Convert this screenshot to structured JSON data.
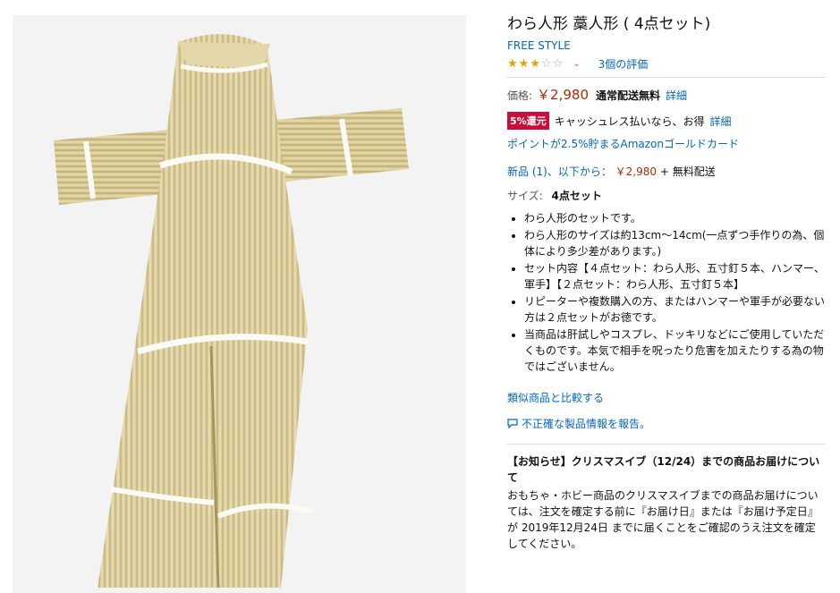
{
  "product": {
    "title": "わら人形 藁人形 ( 4点セット)",
    "brand": "FREE STYLE",
    "stars": {
      "filled": "★★★",
      "empty": "☆☆",
      "rating": 3
    },
    "ratings_link": "3個の評価"
  },
  "price": {
    "label": "価格:",
    "value": "￥2,980",
    "shipping": "通常配送無料",
    "details_link": "詳細"
  },
  "promo": {
    "badge": "5%還元",
    "text": "キャッシュレス払いなら、お得",
    "details_link": "詳細"
  },
  "gold_card": "ポイントが2.5%貯まるAmazonゴールドカード",
  "offers": {
    "link": "新品 (1)、以下から：",
    "price": "￥2,980",
    "shipping": "+ 無料配送"
  },
  "size": {
    "label": "サイズ:",
    "value": "4点セット"
  },
  "bullets": [
    "わら人形のセットです。",
    "わら人形のサイズは約13cm～14cm(一点ずつ手作りの為、個体により多少差があります。)",
    "セット内容【４点セット：わら人形、五寸釘５本、ハンマー、軍手】【２点セット：わら人形、五寸釘５本】",
    "リピーターや複数購入の方、またはハンマーや軍手が必要ない方は２点セットがお徳です。",
    "当商品は肝試しやコスプレ、ドッキリなどにご使用していただくものです。本気で相手を呪ったり危害を加えたりする為の物ではございません。"
  ],
  "compare_link": "類似商品と比較する",
  "report_link": "不正確な製品情報を報告。",
  "notice": {
    "title": "【お知らせ】クリスマスイブ（12/24）までの商品お届けについて",
    "body": "おもちゃ・ホビー商品のクリスマスイブまでの商品お届けについては、注文を確定する前に『お届け日』または『お届け予定日』が 2019年12月24日 までに届くことをご確認のうえ注文を確定してください。"
  },
  "colors": {
    "link": "#0066c0",
    "price": "#b12704",
    "badge": "#cc0c39",
    "star": "#e6a100"
  },
  "icons": {
    "chevron": "chevron-down-icon",
    "report": "speech-bubble-icon"
  }
}
